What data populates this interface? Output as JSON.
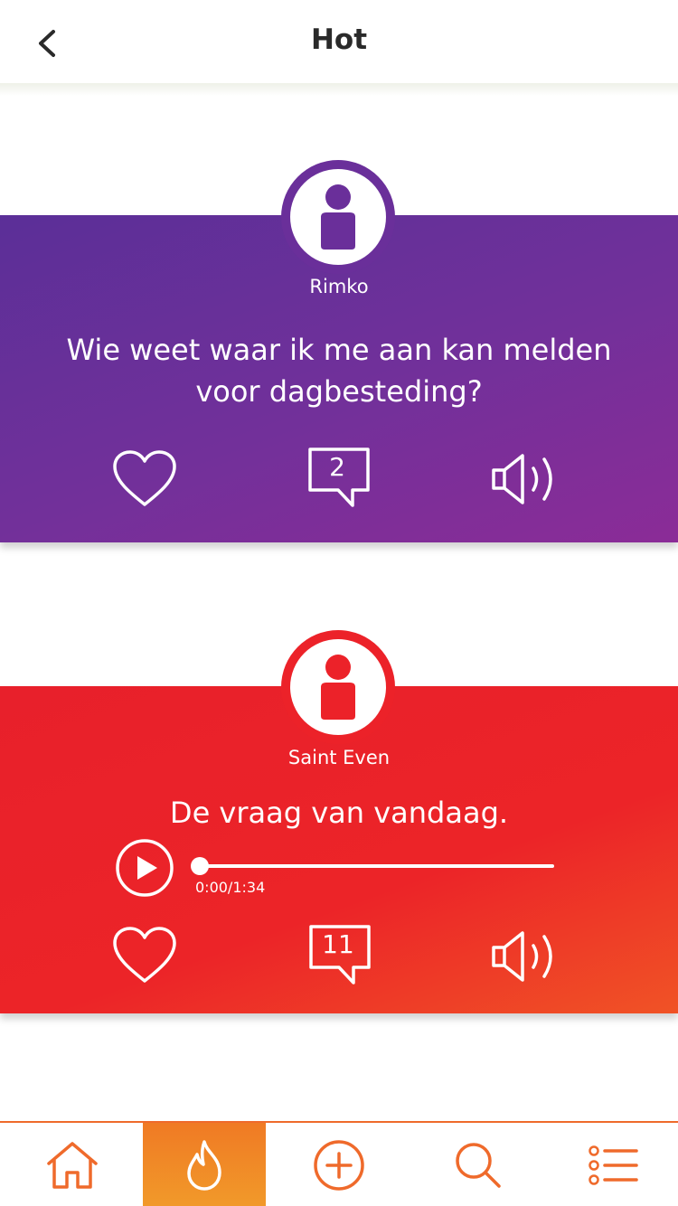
{
  "header": {
    "title": "Hot"
  },
  "posts": [
    {
      "username": "Rimko",
      "question": "Wie weet waar ik me aan kan melden voor dagbesteding?",
      "comment_count": "2"
    },
    {
      "username": "Saint Even",
      "question": "De vraag van vandaag.",
      "audio_time": "0:00/1:34",
      "audio_progress": 0,
      "comment_count": "11"
    }
  ],
  "nav": {
    "active": "hot",
    "items": [
      "home-icon",
      "flame-icon",
      "plus-circle-icon",
      "search-icon",
      "list-icon"
    ]
  },
  "colors": {
    "purple": "#6a2f9a",
    "red": "#ec2229",
    "orange": "#ef6a2b"
  }
}
